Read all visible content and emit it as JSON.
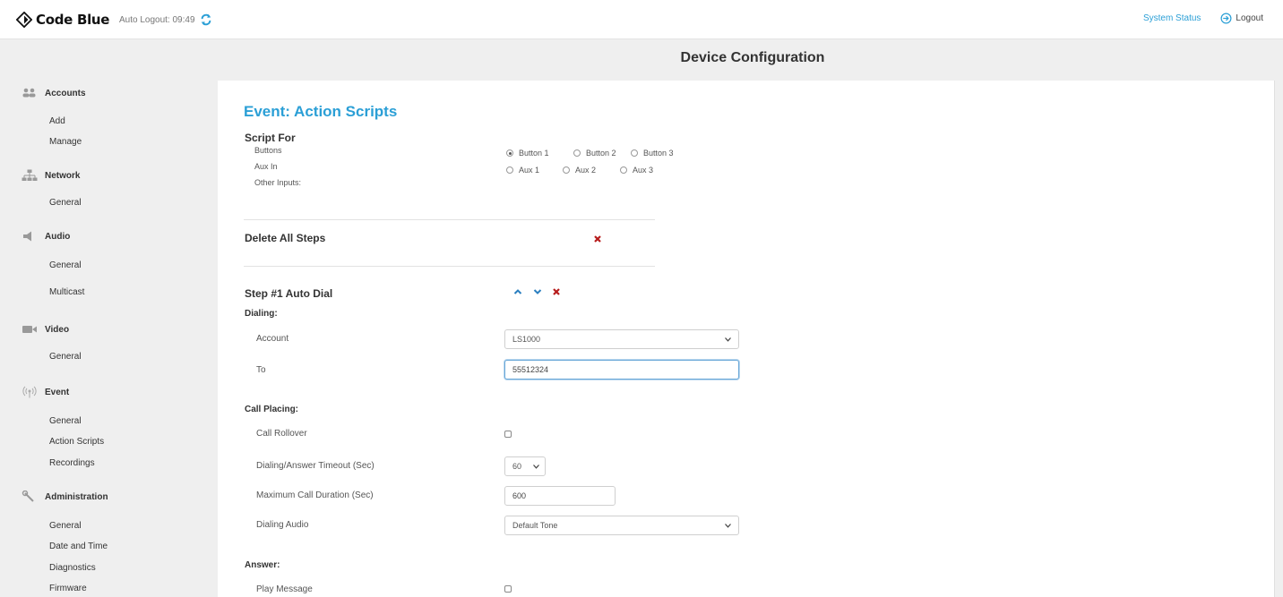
{
  "header": {
    "brand": "Code Blue",
    "auto_logout": "Auto Logout: 09:49",
    "system_status": "System Status",
    "logout": "Logout"
  },
  "page_title": "Device Configuration",
  "sidebar": {
    "sections": [
      {
        "label": "Accounts",
        "icon": "users-icon",
        "items": [
          "Add",
          "Manage"
        ]
      },
      {
        "label": "Network",
        "icon": "network-icon",
        "items": [
          "General"
        ]
      },
      {
        "label": "Audio",
        "icon": "speaker-icon",
        "items": [
          "General",
          "Multicast"
        ]
      },
      {
        "label": "Video",
        "icon": "camera-icon",
        "items": [
          "General"
        ]
      },
      {
        "label": "Event",
        "icon": "broadcast-icon",
        "items": [
          "General",
          "Action Scripts",
          "Recordings"
        ]
      },
      {
        "label": "Administration",
        "icon": "wrench-icon",
        "items": [
          "General",
          "Date and Time",
          "Diagnostics",
          "Firmware"
        ]
      }
    ]
  },
  "main": {
    "title": "Event: Action Scripts",
    "script_for": {
      "heading": "Script For",
      "buttons_label": "Buttons",
      "buttons": [
        "Button 1",
        "Button 2",
        "Button 3"
      ],
      "selected_button": "Button 1",
      "aux_label": "Aux In",
      "aux": [
        "Aux 1",
        "Aux 2",
        "Aux 3"
      ],
      "other_label": "Other Inputs:"
    },
    "delete_all": "Delete All Steps",
    "step": {
      "title": "Step #1 Auto Dial",
      "dialing_heading": "Dialing:",
      "account_label": "Account",
      "account_value": "LS1000",
      "to_label": "To",
      "to_value": "55512324",
      "call_placing_heading": "Call Placing:",
      "call_rollover_label": "Call Rollover",
      "timeout_label": "Dialing/Answer Timeout (Sec)",
      "timeout_value": "60",
      "max_duration_label": "Maximum Call Duration (Sec)",
      "max_duration_value": "600",
      "dialing_audio_label": "Dialing Audio",
      "dialing_audio_value": "Default Tone",
      "answer_heading": "Answer:",
      "play_message_label": "Play Message"
    }
  },
  "colors": {
    "accent": "#2b9fd6",
    "delete": "#b71c1c",
    "sidebar_bg": "#efefef"
  }
}
